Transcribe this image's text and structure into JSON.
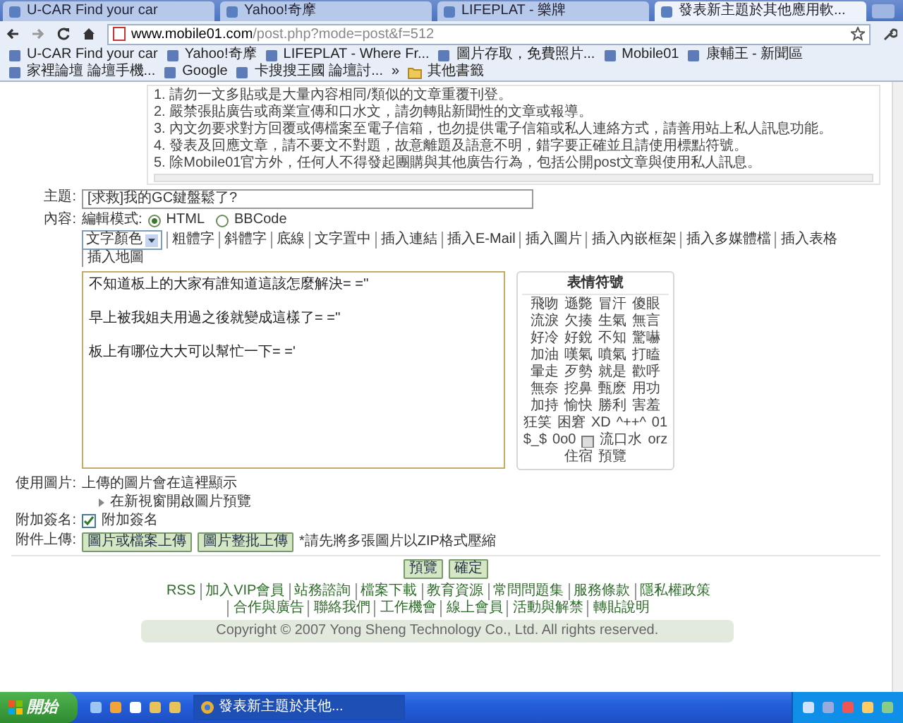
{
  "browser": {
    "tabs": [
      {
        "title": "U-CAR Find your car",
        "selected": false
      },
      {
        "title": "Yahoo!奇摩",
        "selected": false
      },
      {
        "title": "LIFEPLAT - 樂牌",
        "selected": false
      },
      {
        "title": "發表新主題於其他應用軟...",
        "selected": true
      }
    ],
    "address": {
      "host": "www.mobile01.com",
      "path": "/post.php?mode=post&f=512"
    },
    "bookmarks": [
      "U-CAR Find your car",
      "Yahoo!奇摩",
      "LIFEPLAT - Where Fr...",
      "圖片存取，免費照片...",
      "Mobile01",
      "康輔王 - 新聞區",
      "家裡論壇 論壇手機...",
      "Google",
      "卡搜搜王國 論壇討..."
    ],
    "more": "»",
    "other_bookmarks": "其他書籤"
  },
  "rules": [
    "1. 請勿一文多貼或是大量內容相同/類似的文章重覆刊登。",
    "2. 嚴禁張貼廣告或商業宣傳和口水文，請勿轉貼新聞性的文章或報導。",
    "3. 內文勿要求對方回覆或傳檔案至電子信箱，也勿提供電子信箱或私人連絡方式，請善用站上私人訊息功能。",
    "4. 發表及回應文章，請不要文不對題，故意離題及語意不明，錯字要正確並且請使用標點符號。",
    "5. 除Mobile01官方外，任何人不得發起團購與其他廣告行為，包括公開post文章與使用私人訊息。"
  ],
  "form": {
    "subject": {
      "label": "主題:",
      "value": "[求救]我的GC鍵盤鬆了?"
    },
    "content": {
      "label": "內容:",
      "mode_label": "編輯模式:",
      "modes": [
        {
          "label": "HTML",
          "selected": true
        },
        {
          "label": "BBCode",
          "selected": false
        }
      ],
      "color_select": "文字顏色",
      "tools": [
        "粗體字",
        "斜體字",
        "底線",
        "文字置中",
        "插入連結",
        "插入E-Mail",
        "插入圖片",
        "插入內嵌框架",
        "插入多媒體檔",
        "插入表格",
        "插入地圖"
      ],
      "body_lines": [
        "不知道板上的大家有誰知道這該怎麼解決= =''",
        "早上被我姐夫用過之後就變成這樣了= =''",
        "板上有哪位大大可以幫忙一下= ='"
      ],
      "emoticons": {
        "title": "表情符號",
        "items": [
          {
            "kind": "text",
            "label": "飛吻"
          },
          {
            "kind": "text",
            "label": "遜斃"
          },
          {
            "kind": "text",
            "label": "冒汗"
          },
          {
            "kind": "text",
            "label": "傻眼"
          },
          {
            "kind": "text",
            "label": "流淚"
          },
          {
            "kind": "text",
            "label": "欠揍"
          },
          {
            "kind": "text",
            "label": "生氣"
          },
          {
            "kind": "text",
            "label": "無言"
          },
          {
            "kind": "text",
            "label": "好冷"
          },
          {
            "kind": "text",
            "label": "好銳"
          },
          {
            "kind": "text",
            "label": "不知"
          },
          {
            "kind": "text",
            "label": "驚嚇"
          },
          {
            "kind": "text",
            "label": "加油"
          },
          {
            "kind": "text",
            "label": "嘆氣"
          },
          {
            "kind": "text",
            "label": "噴氣"
          },
          {
            "kind": "text",
            "label": "打瞌"
          },
          {
            "kind": "text",
            "label": "暈走"
          },
          {
            "kind": "text",
            "label": "歹勢"
          },
          {
            "kind": "text",
            "label": "就是"
          },
          {
            "kind": "text",
            "label": "歡呼"
          },
          {
            "kind": "text",
            "label": "無奈"
          },
          {
            "kind": "text",
            "label": "挖鼻"
          },
          {
            "kind": "text",
            "label": "甄麽"
          },
          {
            "kind": "text",
            "label": "用功"
          },
          {
            "kind": "text",
            "label": "加持"
          },
          {
            "kind": "text",
            "label": "愉快"
          },
          {
            "kind": "text",
            "label": "勝利"
          },
          {
            "kind": "text",
            "label": "害羞"
          },
          {
            "kind": "text",
            "label": "狂笑"
          },
          {
            "kind": "text",
            "label": "困窘"
          },
          {
            "kind": "text",
            "label": "XD"
          },
          {
            "kind": "text",
            "label": "^++^"
          },
          {
            "kind": "text",
            "label": "01"
          },
          {
            "kind": "text",
            "label": "$_$"
          },
          {
            "kind": "text",
            "label": "0o0"
          },
          {
            "kind": "image"
          },
          {
            "kind": "text",
            "label": "流口水"
          },
          {
            "kind": "text",
            "label": "orz"
          },
          {
            "kind": "text",
            "label": "住宿"
          },
          {
            "kind": "text",
            "label": "預覽"
          }
        ]
      }
    },
    "image": {
      "label": "使用圖片:",
      "hint": "上傳的圖片會在這裡顯示"
    },
    "preview_link": "在新視窗開啟圖片預覽",
    "signature": {
      "label": "附加簽名:",
      "checked": true,
      "text": "附加簽名"
    },
    "attach": {
      "label": "附件上傳:",
      "buttons": [
        "圖片或檔案上傳",
        "圖片整批上傳"
      ],
      "note": "*請先將多張圖片以ZIP格式壓縮"
    },
    "actions": [
      "預覽",
      "確定"
    ]
  },
  "footer": {
    "links": [
      "RSS",
      "加入VIP會員",
      "站務諮詢",
      "檔案下載",
      "教育資源",
      "常問問題集",
      "服務條款",
      "隱私權政策",
      "合作與廣告",
      "聯絡我們",
      "工作機會",
      "線上會員",
      "活動與解禁",
      "轉貼說明"
    ],
    "copyright": "Copyright © 2007 Yong Sheng Technology Co., Ltd. All rights reserved."
  },
  "taskbar": {
    "start": "開始",
    "windows": [
      {
        "title": "發表新主題於其他...",
        "selected": true
      }
    ]
  }
}
